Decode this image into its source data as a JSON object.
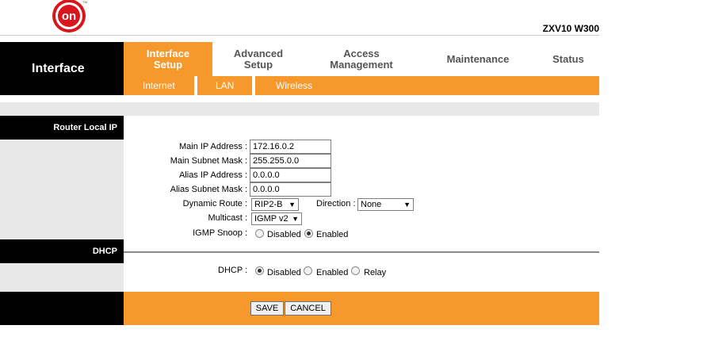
{
  "header": {
    "logo_text": "on",
    "model": "ZXV10 W300"
  },
  "nav": {
    "section_title": "Interface",
    "tabs": [
      {
        "label1": "Interface",
        "label2": "Setup"
      },
      {
        "label1": "Advanced",
        "label2": "Setup"
      },
      {
        "label1": "Access",
        "label2": "Management"
      },
      {
        "label1": "Maintenance",
        "label2": ""
      },
      {
        "label1": "Status",
        "label2": ""
      }
    ],
    "subtabs": [
      "Internet",
      "LAN",
      "Wireless"
    ]
  },
  "router_local_ip": {
    "title": "Router Local IP",
    "main_ip_label": "Main IP Address",
    "main_ip_value": "172.16.0.2",
    "main_mask_label": "Main Subnet Mask",
    "main_mask_value": "255.255.0.0",
    "alias_ip_label": "Alias IP Address",
    "alias_ip_value": "0.0.0.0",
    "alias_mask_label": "Alias Subnet Mask",
    "alias_mask_value": "0.0.0.0",
    "dynamic_route_label": "Dynamic Route",
    "dynamic_route_value": "RIP2-B",
    "direction_label": "Direction",
    "direction_value": "None",
    "multicast_label": "Multicast",
    "multicast_value": "IGMP v2",
    "igmp_snoop_label": "IGMP Snoop",
    "igmp_disabled": "Disabled",
    "igmp_enabled": "Enabled",
    "igmp_selected": "Enabled",
    "colon": ":"
  },
  "dhcp": {
    "title": "DHCP",
    "label": "DHCP",
    "opt_disabled": "Disabled",
    "opt_enabled": "Enabled",
    "opt_relay": "Relay",
    "selected": "Disabled"
  },
  "footer": {
    "save": "SAVE",
    "cancel": "CANCEL"
  },
  "colors": {
    "accent": "#f7982d",
    "nav_dark": "#000000",
    "band": "#e8e8e8"
  }
}
